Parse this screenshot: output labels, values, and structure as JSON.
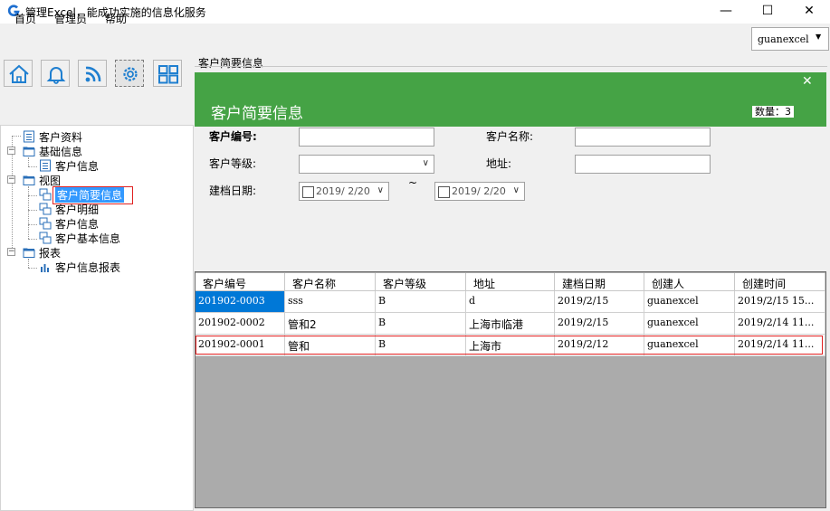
{
  "window": {
    "title": "管理Excel，能成功实施的信息化服务",
    "min_glyph": "—",
    "max_glyph": "☐",
    "close_glyph": "✕"
  },
  "menu": {
    "home": "首页",
    "admin": "管理员",
    "help": "帮助"
  },
  "user_select": {
    "value": "guanexcel",
    "arrow": "▼"
  },
  "toolbar": {
    "icons": [
      "home-icon",
      "bell-icon",
      "rss-icon",
      "gear-icon",
      "grid-icon"
    ]
  },
  "tree": {
    "customer_data": "客户资料",
    "basic_info": "基础信息",
    "basic_customer_info": "客户信息",
    "view": "视图",
    "view_summary": "客户简要信息",
    "view_detail": "客户明细",
    "view_customer_info": "客户信息",
    "view_basic": "客户基本信息",
    "report": "报表",
    "report_customer_info": "客户信息报表",
    "expander_open": "−"
  },
  "panel": {
    "caption": "客户简要信息",
    "title": "客户简要信息",
    "close_glyph": "✕",
    "count_label": "数量：3",
    "accent_color": "#45a345"
  },
  "form": {
    "code_label": "客户编号:",
    "name_label": "客户名称:",
    "level_label": "客户等级:",
    "address_label": "地址:",
    "date_label": "建档日期:",
    "date_from": "2019/ 2/20",
    "date_to": "2019/ 2/20",
    "range_sep": "~",
    "arrow": "∨"
  },
  "grid": {
    "headers": [
      "客户编号",
      "客户名称",
      "客户等级",
      "地址",
      "建档日期",
      "创建人",
      "创建时间"
    ],
    "rows": [
      [
        "201902-0003",
        "sss",
        "B",
        "d",
        "2019/2/15",
        "guanexcel",
        "2019/2/15 15..."
      ],
      [
        "201902-0002",
        "管和2",
        "B",
        "上海市临港",
        "2019/2/15",
        "guanexcel",
        "2019/2/14 11..."
      ],
      [
        "201902-0001",
        "管和",
        "B",
        "上海市",
        "2019/2/12",
        "guanexcel",
        "2019/2/14 11..."
      ]
    ]
  }
}
